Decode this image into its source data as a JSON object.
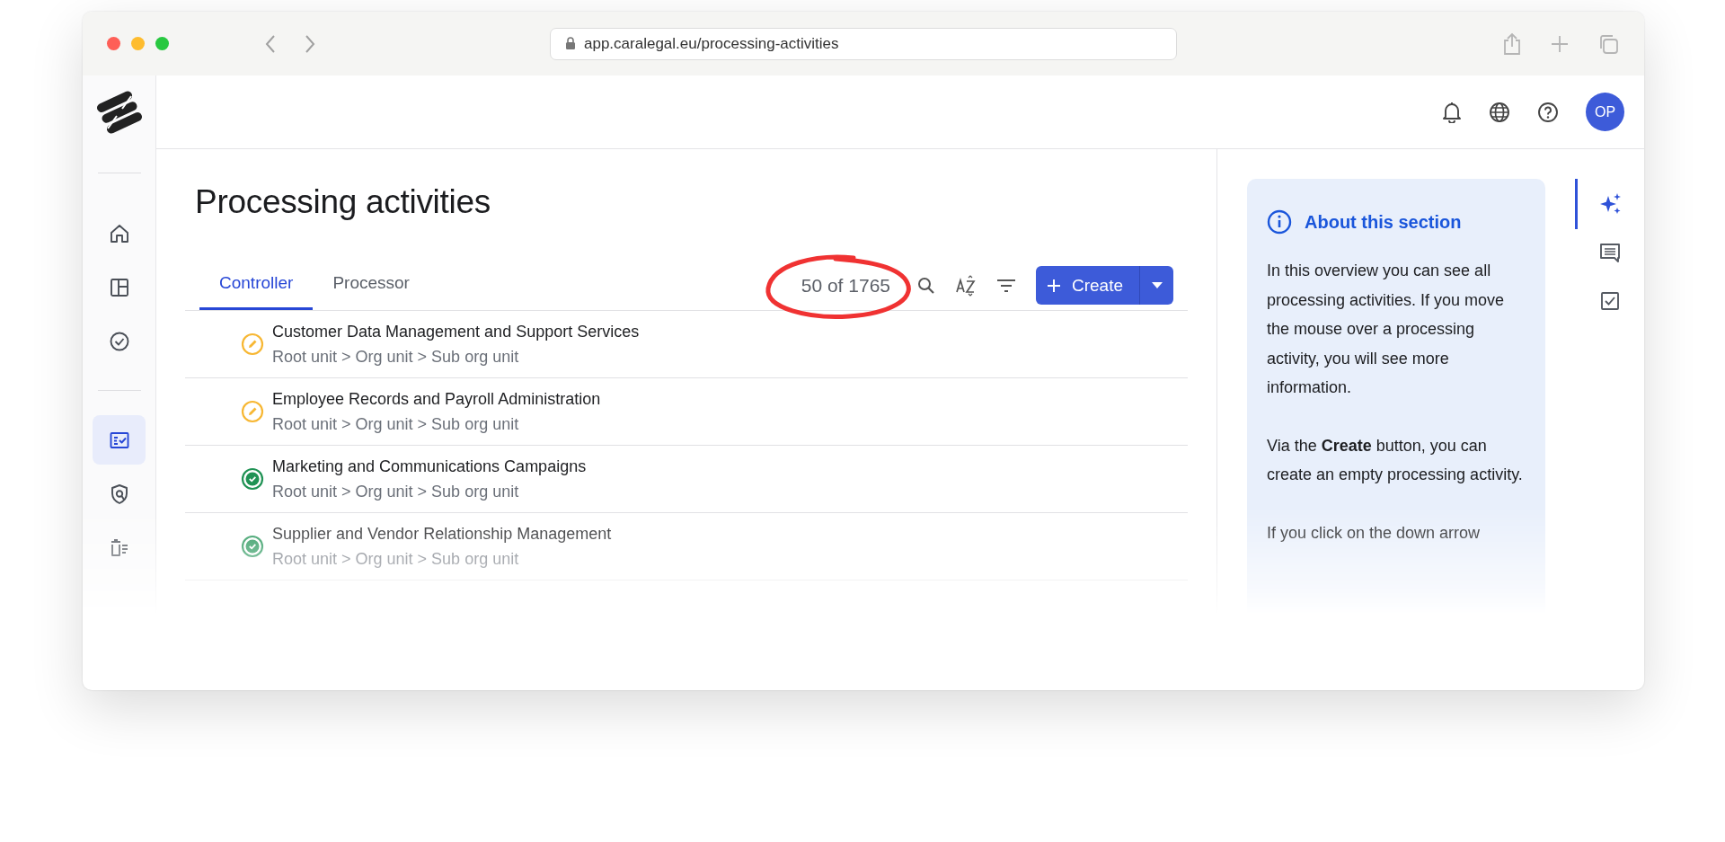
{
  "browser": {
    "url": "app.caralegal.eu/processing-activities"
  },
  "sidebar": {
    "items": [
      {
        "kind": "home",
        "selected": false
      },
      {
        "kind": "layout",
        "selected": false
      },
      {
        "kind": "check",
        "selected": false
      },
      {
        "kind": "divider"
      },
      {
        "kind": "records",
        "selected": true
      },
      {
        "kind": "shield",
        "selected": false
      },
      {
        "kind": "delete-list",
        "selected": false
      }
    ]
  },
  "header": {
    "avatar": "OP"
  },
  "page": {
    "title": "Processing activities"
  },
  "tabs": [
    {
      "label": "Controller",
      "selected": true
    },
    {
      "label": "Processor",
      "selected": false
    }
  ],
  "toolbar": {
    "count": "50 of 1765",
    "create_button": "Create"
  },
  "activities": [
    {
      "title": "Customer Data Management and Support Services",
      "path": "Root unit > Org unit > Sub org unit",
      "kind": "draft"
    },
    {
      "title": "Employee Records and Payroll Administration",
      "path": "Root unit > Org unit > Sub org unit",
      "kind": "draft"
    },
    {
      "title": "Marketing and Communications Campaigns",
      "path": "Root unit > Org unit > Sub org unit",
      "kind": "approved"
    },
    {
      "title": "Supplier and Vendor Relationship Management",
      "path": "Root unit > Org unit > Sub org unit",
      "kind": "approved"
    }
  ],
  "info_panel": {
    "title": "About this section",
    "paragraphs": [
      "In this overview you can see all processing activities. If you move the mouse over a processing activity, you will see more information.",
      "Via the **Create** button, you can create an empty processing activity.",
      "If you click on the down arrow"
    ]
  },
  "rail": [
    {
      "kind": "sparkle",
      "selected": true
    },
    {
      "kind": "comments",
      "selected": false
    },
    {
      "kind": "tasks",
      "selected": false
    }
  ]
}
